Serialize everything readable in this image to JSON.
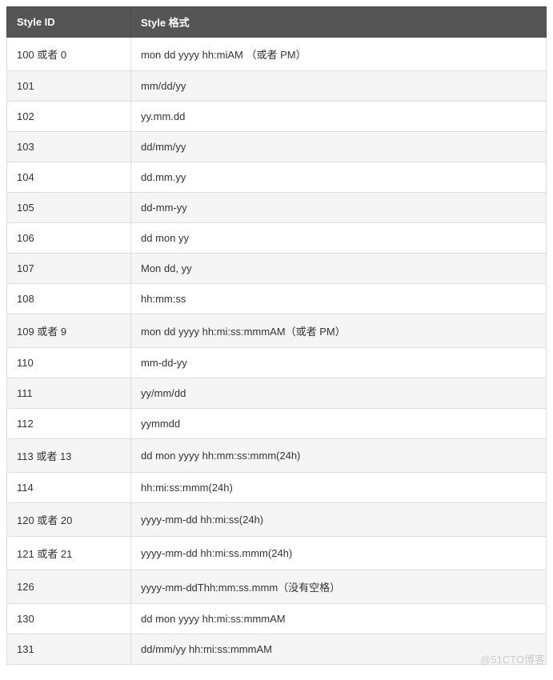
{
  "table": {
    "headers": [
      "Style ID",
      "Style 格式"
    ],
    "rows": [
      {
        "id": "100 或者 0",
        "format": "mon dd yyyy hh:miAM （或者 PM）"
      },
      {
        "id": "101",
        "format": "mm/dd/yy"
      },
      {
        "id": "102",
        "format": "yy.mm.dd"
      },
      {
        "id": "103",
        "format": "dd/mm/yy"
      },
      {
        "id": "104",
        "format": "dd.mm.yy"
      },
      {
        "id": "105",
        "format": "dd-mm-yy"
      },
      {
        "id": "106",
        "format": "dd mon yy"
      },
      {
        "id": "107",
        "format": "Mon dd, yy"
      },
      {
        "id": "108",
        "format": "hh:mm:ss"
      },
      {
        "id": "109 或者 9",
        "format": "mon dd yyyy hh:mi:ss:mmmAM（或者 PM）"
      },
      {
        "id": "110",
        "format": "mm-dd-yy"
      },
      {
        "id": "111",
        "format": "yy/mm/dd"
      },
      {
        "id": "112",
        "format": "yymmdd"
      },
      {
        "id": "113 或者 13",
        "format": "dd mon yyyy hh:mm:ss:mmm(24h)"
      },
      {
        "id": "114",
        "format": "hh:mi:ss:mmm(24h)"
      },
      {
        "id": "120 或者 20",
        "format": "yyyy-mm-dd hh:mi:ss(24h)"
      },
      {
        "id": "121 或者 21",
        "format": "yyyy-mm-dd hh:mi:ss.mmm(24h)"
      },
      {
        "id": "126",
        "format": "yyyy-mm-ddThh:mm:ss.mmm（没有空格）"
      },
      {
        "id": "130",
        "format": "dd mon yyyy hh:mi:ss:mmmAM"
      },
      {
        "id": "131",
        "format": "dd/mm/yy hh:mi:ss:mmmAM"
      }
    ]
  },
  "watermark": "@51CTO博客"
}
